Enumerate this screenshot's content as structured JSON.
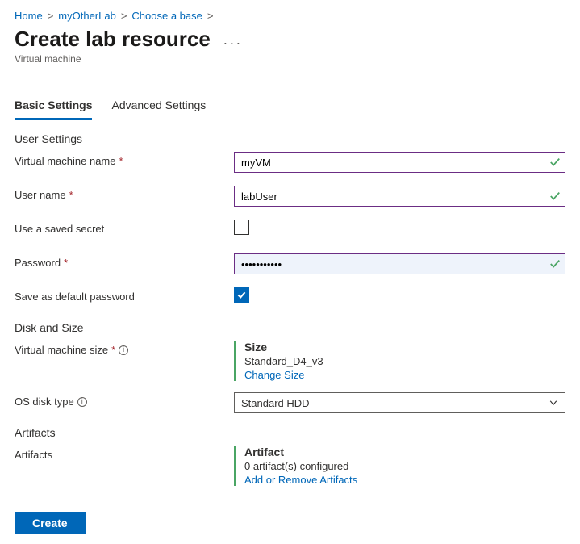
{
  "breadcrumb": {
    "items": [
      "Home",
      "myOtherLab",
      "Choose a base"
    ]
  },
  "header": {
    "title": "Create lab resource",
    "subtitle": "Virtual machine"
  },
  "tabs": {
    "basic": "Basic Settings",
    "advanced": "Advanced Settings"
  },
  "sections": {
    "user_settings": "User Settings",
    "disk_size": "Disk and Size",
    "artifacts": "Artifacts"
  },
  "labels": {
    "vm_name": "Virtual machine name",
    "user_name": "User name",
    "use_saved_secret": "Use a saved secret",
    "password": "Password",
    "save_default_pw": "Save as default password",
    "vm_size": "Virtual machine size",
    "os_disk_type": "OS disk type",
    "artifacts": "Artifacts"
  },
  "fields": {
    "vm_name": "myVM",
    "user_name": "labUser",
    "password": "•••••••••••",
    "os_disk_type": "Standard HDD"
  },
  "size_block": {
    "heading": "Size",
    "value": "Standard_D4_v3",
    "link": "Change Size"
  },
  "artifact_block": {
    "heading": "Artifact",
    "value": "0 artifact(s) configured",
    "link": "Add or Remove Artifacts"
  },
  "buttons": {
    "create": "Create"
  }
}
